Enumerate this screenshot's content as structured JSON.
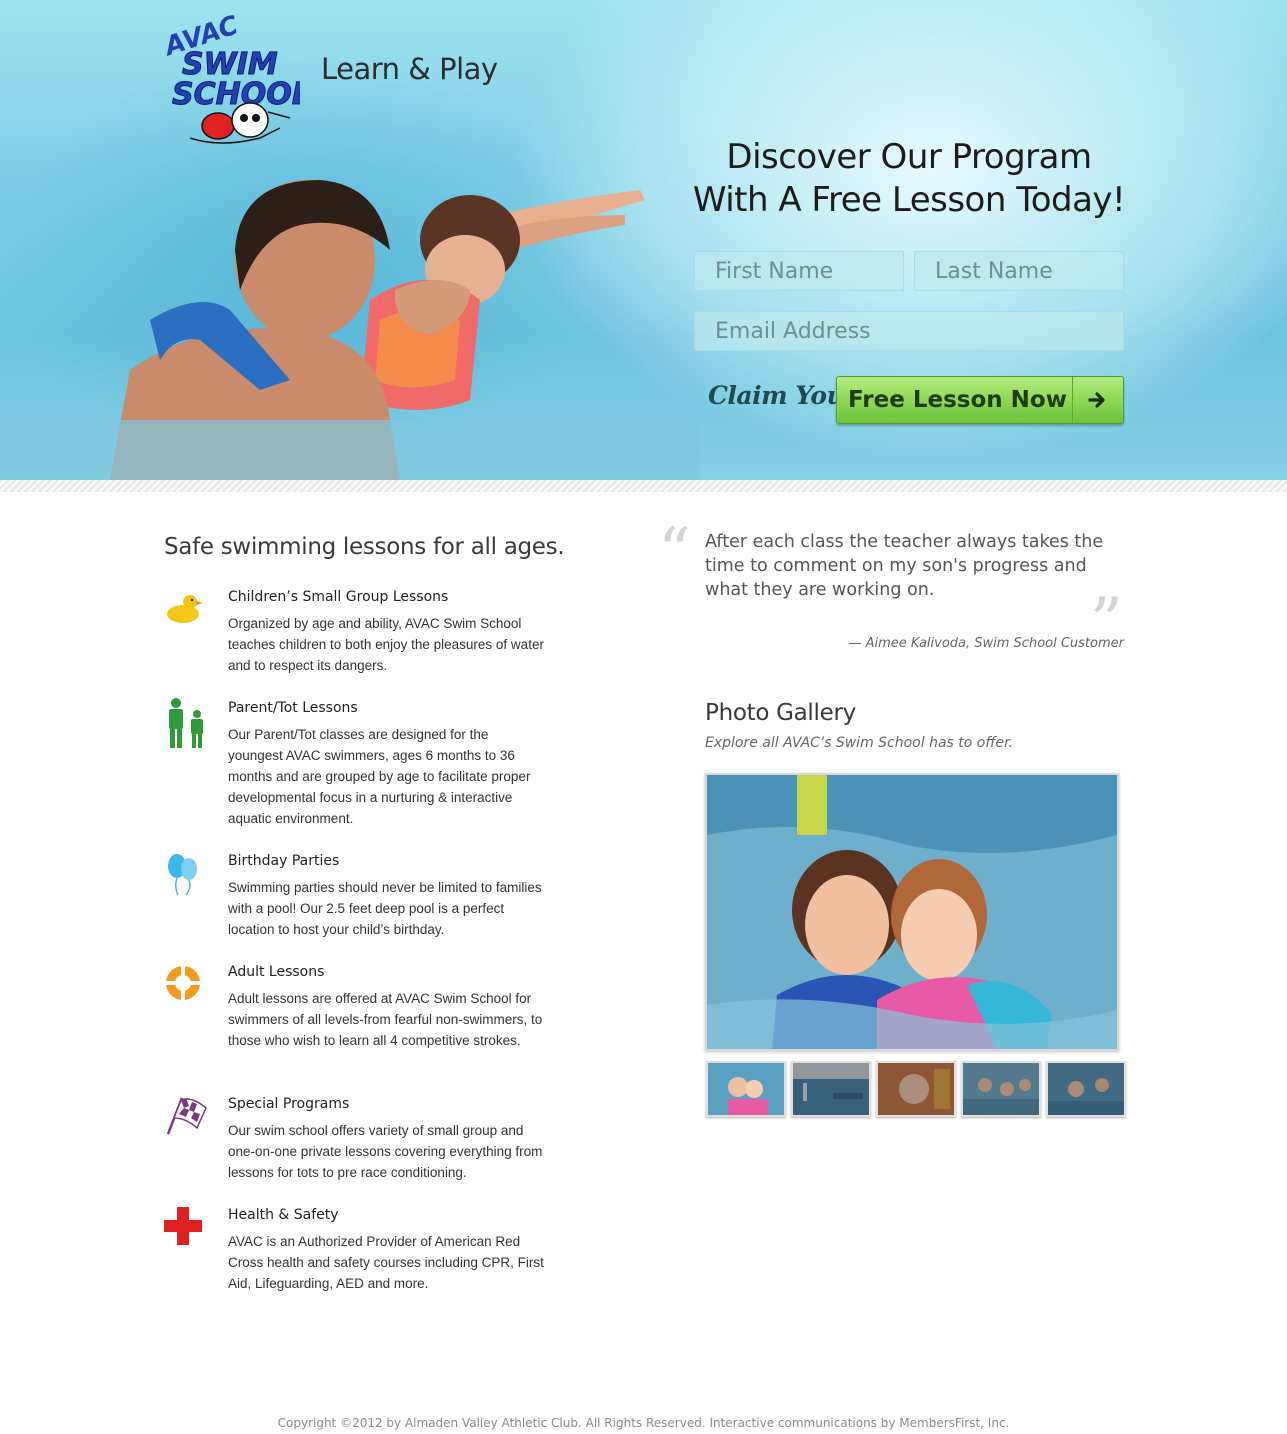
{
  "header": {
    "logo_text_top": "AVAC",
    "logo_text_line1": "SWIM",
    "logo_text_line2": "SCHOOL",
    "tagline": "Learn & Play"
  },
  "signup": {
    "title_line1": "Discover Our Program",
    "title_line2": "With A Free Lesson Today!",
    "first_name_placeholder": "First Name",
    "last_name_placeholder": "Last Name",
    "email_placeholder": "Email Address",
    "claim_text": "Claim Your",
    "cta_label": "Free Lesson Now",
    "cta_icon": "arrow-right-icon"
  },
  "programs": {
    "section_title": "Safe swimming lessons for all ages.",
    "items": [
      {
        "icon": "duck-icon",
        "title": "Children’s Small Group Lessons",
        "desc": "Organized by age and ability, AVAC Swim School teaches children to both enjoy the pleasures of water and to respect its dangers."
      },
      {
        "icon": "parent-child-icon",
        "title": "Parent/Tot Lessons",
        "desc": "Our Parent/Tot classes are designed for the youngest AVAC swimmers, ages 6 months to 36 months and are grouped by age to facilitate proper developmental focus in a nurturing & interactive aquatic environment."
      },
      {
        "icon": "balloons-icon",
        "title": "Birthday Parties",
        "desc": "Swimming parties should never be limited to families with a pool! Our 2.5 feet deep pool is a perfect location to host your child’s birthday."
      },
      {
        "icon": "life-ring-icon",
        "title": "Adult Lessons",
        "desc": "Adult lessons are offered at AVAC Swim School for swimmers of all levels-from fearful non-swimmers, to those who wish to learn all 4 competitive strokes."
      },
      {
        "icon": "checkered-flag-icon",
        "title": "Special Programs",
        "desc": "Our swim school offers variety of small group and one-on-one private lessons covering everything from lessons for tots to pre race conditioning."
      },
      {
        "icon": "red-cross-icon",
        "title": "Health & Safety",
        "desc": "AVAC is an Authorized Provider of American Red Cross health and safety courses including CPR, First Aid, Lifeguarding, AED and more."
      }
    ]
  },
  "testimonial": {
    "text": "After each class the teacher always takes the time to comment on my son's progress and what they are working on.",
    "attribution": "— Aimee Kalivoda, Swim School Customer"
  },
  "gallery": {
    "title": "Photo Gallery",
    "subtitle": "Explore all AVAC’s Swim School has to offer.",
    "thumbnail_count": 5,
    "selected_index": 0
  },
  "footer": {
    "text": "Copyright ©2012 by Almaden Valley Athletic Club. All Rights Reserved. Interactive communications by MembersFirst, Inc."
  },
  "colors": {
    "accent_green": "#8fd756",
    "logo_blue": "#1f3fb0",
    "hero_water": "#7fd0e6"
  }
}
